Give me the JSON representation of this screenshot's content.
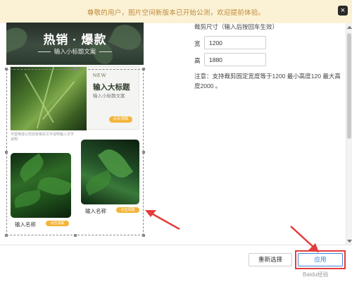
{
  "notice": {
    "text": "尊敬的用户，图片空间新版本已开始公测，欢迎提前体验。",
    "close_icon": "close-icon"
  },
  "poster": {
    "hero_title": "热销 · 爆款",
    "hero_subtitle": "输入小标题文案",
    "card_new": "NEW",
    "card_title": "输入大标题",
    "card_subtitle": "输入小标题文案",
    "card_button": "点击领取",
    "description": "可替换成公司自有相关文字说明输入文字说明",
    "left_label": "输入名称",
    "left_button": "点击领取",
    "right_label": "输入名称",
    "right_button": "点击领取"
  },
  "settings": {
    "size_label": "裁剪尺寸（输入后按回车生效）",
    "width_key": "宽",
    "width_value": "1200",
    "height_key": "高",
    "height_value": "1880",
    "note": "注意：支持裁剪固定宽度等于1200 最小高度120 最大高度2000 。"
  },
  "footer": {
    "reset_label": "重新选择",
    "apply_label": "应用",
    "watermark": "Baidu经验"
  },
  "colors": {
    "notice_bg": "#fbf2d5",
    "notice_text": "#c08a3a",
    "accent": "#2f7fd3",
    "highlight": "#e53b3b",
    "poster_button": "#f2b43a"
  }
}
